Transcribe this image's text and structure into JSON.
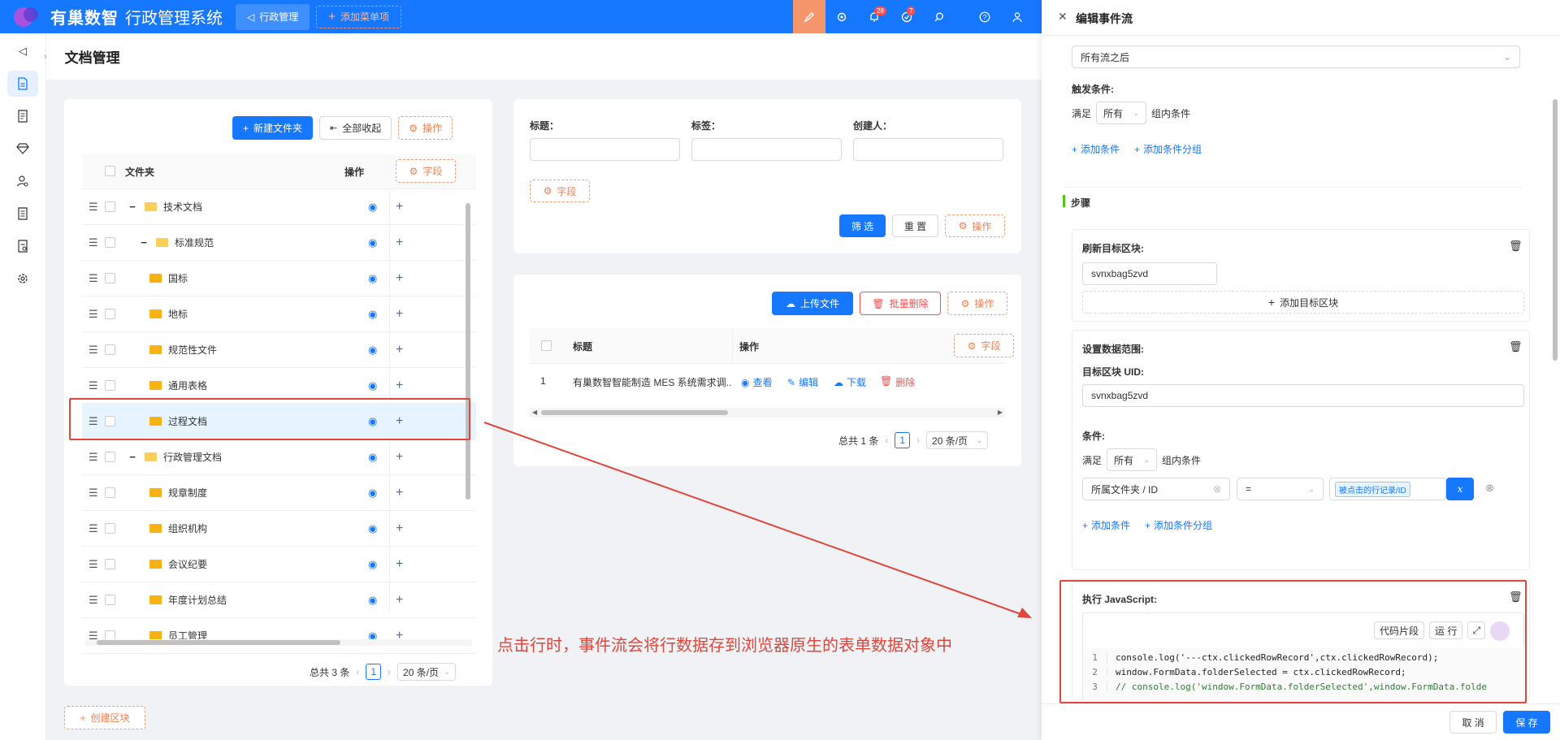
{
  "topbar": {
    "brand": "有巢数智",
    "system_title": "行政管理系统",
    "nav_tab": "行政管理",
    "add_menu": "添加菜单项",
    "badge_bell": "28",
    "badge_task": "7"
  },
  "page": {
    "title": "文档管理",
    "create_block": "创建区块"
  },
  "folder_panel": {
    "new_folder": "新建文件夹",
    "collapse_all": "全部收起",
    "ops": "操作",
    "fields": "字段",
    "col_folder": "文件夹",
    "col_ops": "操作",
    "rows": [
      {
        "name": "技术文档",
        "indent": 0,
        "exp": "−"
      },
      {
        "name": "标准规范",
        "indent": 1,
        "exp": "−"
      },
      {
        "name": "国标",
        "indent": 2,
        "exp": ""
      },
      {
        "name": "地标",
        "indent": 2,
        "exp": ""
      },
      {
        "name": "规范性文件",
        "indent": 1,
        "exp": ""
      },
      {
        "name": "通用表格",
        "indent": 1,
        "exp": ""
      },
      {
        "name": "过程文档",
        "indent": 1,
        "exp": ""
      },
      {
        "name": "行政管理文档",
        "indent": 0,
        "exp": "−"
      },
      {
        "name": "规章制度",
        "indent": 1,
        "exp": ""
      },
      {
        "name": "组织机构",
        "indent": 1,
        "exp": ""
      },
      {
        "name": "会议纪要",
        "indent": 1,
        "exp": ""
      },
      {
        "name": "年度计划总结",
        "indent": 1,
        "exp": ""
      },
      {
        "name": "员工管理",
        "indent": 1,
        "exp": ""
      }
    ],
    "total": "总共 3 条",
    "page": "1",
    "page_size": "20 条/页"
  },
  "filter_panel": {
    "title_label": "标题：",
    "tag_label": "标签：",
    "creator_label": "创建人：",
    "fields": "字段",
    "filter": "筛 选",
    "reset": "重 置",
    "ops": "操作"
  },
  "file_panel": {
    "upload": "上传文件",
    "batch_delete": "批量删除",
    "ops": "操作",
    "fields": "字段",
    "col_title": "标题",
    "col_ops": "操作",
    "rows": [
      {
        "no": "1",
        "title": "有巢数智智能制造 MES 系统需求调...",
        "view": "查看",
        "edit": "编辑",
        "download": "下载",
        "delete": "删除"
      }
    ],
    "total": "总共 1 条",
    "page": "1",
    "page_size": "20 条/页"
  },
  "annotation": "点击行时，事件流会将行数据存到浏览器原生的表单数据对象中",
  "drawer": {
    "title": "编辑事件流",
    "timing": "所有流之后",
    "trigger_label": "触发条件:",
    "satisfy": "满足",
    "all": "所有",
    "group_cond": "组内条件",
    "add_cond": "添加条件",
    "add_group": "添加条件分组",
    "steps": "步骤",
    "refresh": {
      "title": "刷新目标区块:",
      "value": "svnxbag5zvd",
      "add_target": "添加目标区块"
    },
    "datascope": {
      "title": "设置数据范围:",
      "uid_label": "目标区块 UID:",
      "uid": "svnxbag5zvd",
      "cond_label": "条件:",
      "field": "所属文件夹 / ID",
      "op": "=",
      "value": "被点击的行记录/ID",
      "x": "x"
    },
    "js": {
      "title": "执行 JavaScript:",
      "snippets": "代码片段",
      "run": "运 行",
      "lines": [
        {
          "n": "1",
          "code": "console.log('---ctx.clickedRowRecord',ctx.clickedRowRecord);"
        },
        {
          "n": "2",
          "code": "window.FormData.folderSelected = ctx.clickedRowRecord;"
        },
        {
          "n": "3",
          "code": "// console.log('window.FormData.folderSelected',window.FormData.folde"
        }
      ]
    },
    "cancel": "取 消",
    "save": "保 存"
  },
  "colors": {
    "primary": "#1677ff",
    "accent": "#f4956b",
    "highlight": "#e0463b"
  }
}
